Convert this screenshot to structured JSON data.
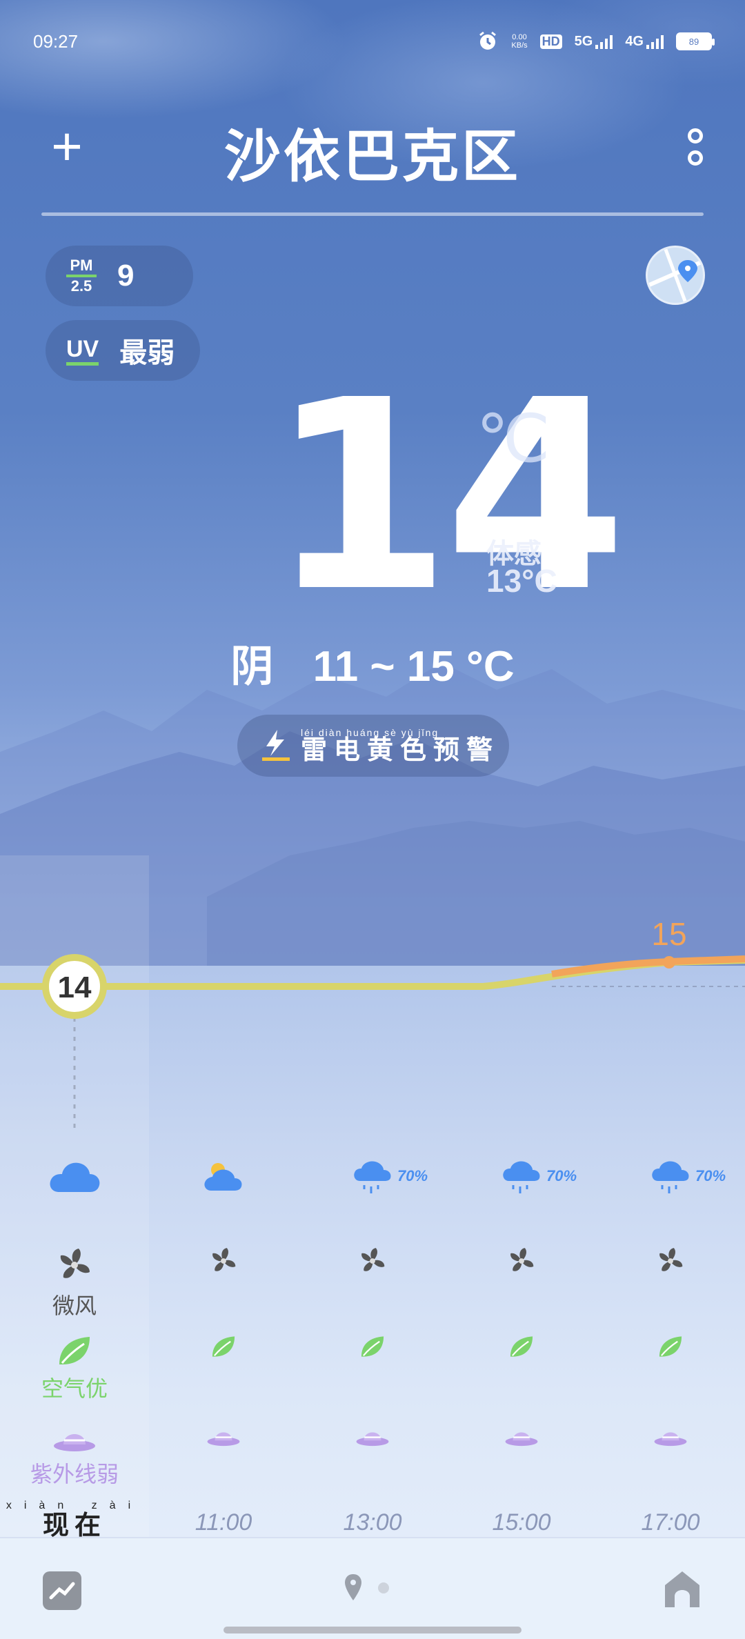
{
  "status_bar": {
    "time": "09:27",
    "net_speed": "0.00",
    "net_unit": "KB/s",
    "hd": "HD",
    "sim1": "5G",
    "sim2": "4G",
    "battery": "89"
  },
  "header": {
    "add_label": "+",
    "city": "沙依巴克区"
  },
  "air": {
    "pm_top": "PM",
    "pm_bottom": "2.5",
    "pm_value": "9",
    "uv_label": "UV",
    "uv_value": "最弱"
  },
  "current": {
    "temperature": "14",
    "unit": "℃",
    "feels_label": "体感",
    "feels_value": "13°C",
    "condition": "阴",
    "range": "11 ~ 15 °C"
  },
  "alert": {
    "pinyin": "léi diàn huáng sè yù jǐng",
    "text": "雷电黄色预警"
  },
  "hourly": {
    "now_temp": "14",
    "peak_temp": "15",
    "now_label_pinyin": "xiàn zài",
    "now_label": "现在",
    "times": [
      "11:00",
      "13:00",
      "15:00",
      "17:00"
    ],
    "rain_pct": [
      "70%",
      "70%",
      "70%"
    ],
    "wind_label": "微风",
    "air_label": "空气优",
    "uv_label": "紫外线弱"
  },
  "colors": {
    "accent_yellow": "#d8d46a",
    "accent_orange": "#f2a45a",
    "leaf_green": "#7bd36b",
    "uv_purple": "#b79ae6",
    "rain_blue": "#4a8ff0"
  }
}
